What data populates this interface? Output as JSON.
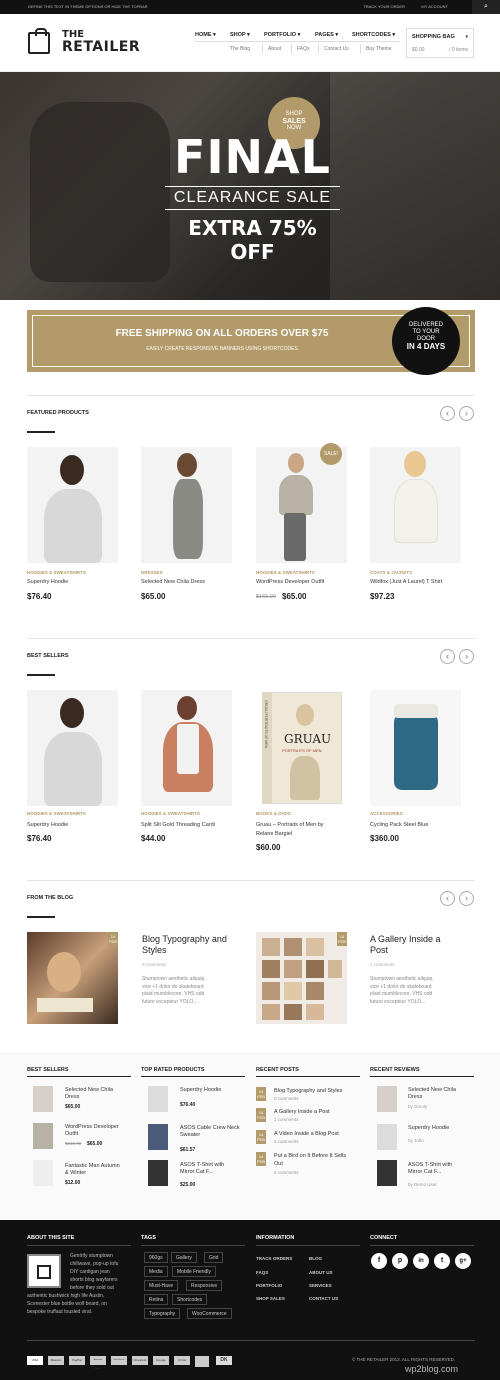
{
  "topbar": {
    "left": "DEFINE THIS TEXT IN THEME OPTIONS OR HIDE THE TOPBAR",
    "track": "TRACK YOUR ORDER",
    "account": "MY ACCOUNT",
    "search": "⌕"
  },
  "logo": {
    "line1": "THE",
    "line2": "RETAILER"
  },
  "nav": {
    "items": [
      "HOME ▾",
      "SHOP ▾",
      "PORTFOLIO ▾",
      "PAGES ▾",
      "SHORTCODES ▾"
    ],
    "sub": [
      "The Blog",
      "About",
      "FAQs",
      "Contact Us",
      "Buy Theme"
    ]
  },
  "bag": {
    "title": "SHOPPING BAG",
    "amount": "$0.00",
    "items": "/ 0 items",
    "chevron": "▾"
  },
  "hero": {
    "badge_top": "SHOP",
    "badge_mid": "SALES",
    "badge_bot": "NOW",
    "title": "FINAL",
    "subtitle": "CLEARANCE SALE",
    "offer": "EXTRA 75% OFF"
  },
  "shipping": {
    "title": "FREE SHIPPING ON ALL ORDERS OVER $75",
    "subtitle": "EASILY CREATE RESPONSIVE BANNERS USING SHORTCODES",
    "b1": "DELIVERED",
    "b2": "TO YOUR",
    "b3": "DOOR",
    "b4": "IN 4 DAYS"
  },
  "arrows": {
    "prev": "‹",
    "next": "›"
  },
  "featured": {
    "title": "FEATURED PRODUCTS",
    "sale": "SALE!",
    "products": [
      {
        "cat": "HOODIES & SWEATSHIRTS",
        "name": "Superdry Hoodie",
        "price": "$76.40",
        "old": ""
      },
      {
        "cat": "DRESSES",
        "name": "Selected New Chila Dress",
        "price": "$65.00",
        "old": ""
      },
      {
        "cat": "HOODIES & SWEATSHIRTS",
        "name": "WordPress Developer Outfit",
        "price": "$65.00",
        "old": "$165.00"
      },
      {
        "cat": "COATS & JACKETS",
        "name": "Wildfox (Just A Laurel) T Shirt",
        "price": "$97.23",
        "old": ""
      }
    ]
  },
  "best": {
    "title": "BEST SELLERS",
    "products": [
      {
        "cat": "HOODIES & SWEATSHIRTS",
        "name": "Superdry Hoodie",
        "name2": "",
        "price": "$76.40"
      },
      {
        "cat": "HOODIES & SWEATSHIRTS",
        "name": "Split Slit Gold Threading Cardi",
        "name2": "",
        "price": "$44.00"
      },
      {
        "cat": "BOOKS & DVDS",
        "name": "Gruau – Portraits of Men by",
        "name2": "Relane Bargiel",
        "price": "$60.00"
      },
      {
        "cat": "ACCESSORIES",
        "name": "Cycling Pack Steel Blue",
        "name2": "",
        "price": "$360.00"
      }
    ],
    "book_title": "GRUAU",
    "book_sub": "PORTRAITS OF MEN",
    "book_spine": "GRUAU PORTRAITS OF MEN"
  },
  "blog": {
    "title": "FROM THE BLOG",
    "posts": [
      {
        "title1": "Blog Typography and",
        "title2": "Styles",
        "meta": "0 comments",
        "text": [
          "Stumptown aesthetic aliquip,",
          "vice +1 dolor do skateboard",
          "plaid mumblecore. VHS odd",
          "future excepteur YOLO..."
        ],
        "day": "14",
        "mon": "FEB"
      },
      {
        "title1": "A Gallery Inside a",
        "title2": "Post",
        "meta": "1 comments",
        "text": [
          "Stumptown aesthetic aliquip,",
          "vice +1 dolor do skateboard",
          "plaid mumblecore. VHS odd",
          "future excepteur YOLO..."
        ],
        "day": "14",
        "mon": "FEB"
      }
    ]
  },
  "widgets": {
    "best": {
      "title": "BEST SELLERS",
      "items": [
        {
          "name": "Selected New Chila",
          "name2": "Dress",
          "price": "$65.00",
          "old": ""
        },
        {
          "name": "WordPress Developer",
          "name2": "Outfit",
          "price": "$65.00",
          "old": "$165.00"
        },
        {
          "name": "Fantastic Man Autumn",
          "name2": "& Winter",
          "price": "$12.00",
          "old": ""
        }
      ]
    },
    "top": {
      "title": "TOP RATED PRODUCTS",
      "items": [
        {
          "name": "Superdry Hoodie",
          "name2": "",
          "price": "$76.40"
        },
        {
          "name": "ASOS Cable Crew Neck",
          "name2": "Sweater",
          "price": "$61.57"
        },
        {
          "name": "ASOS T-Shirt with",
          "name2": "Mirror Cat F...",
          "price": "$25.00"
        }
      ]
    },
    "posts": {
      "title": "RECENT POSTS",
      "items": [
        {
          "day": "14",
          "mon": "FEB",
          "name": "Blog Typography and Styles",
          "name2": "",
          "sub": "0 comments"
        },
        {
          "day": "14",
          "mon": "FEB",
          "name": "A Gallery Inside a Post",
          "name2": "",
          "sub": "1 comments"
        },
        {
          "day": "14",
          "mon": "FEB",
          "name": "A Video Inside a Blog Post",
          "name2": "",
          "sub": "2 comments"
        },
        {
          "day": "14",
          "mon": "FEB",
          "name": "Put a Bird on It Before It Sells",
          "name2": "Out",
          "sub": "6 comments"
        }
      ]
    },
    "reviews": {
      "title": "RECENT REVIEWS",
      "items": [
        {
          "name": "Selected New Chila",
          "name2": "Dress",
          "sub": "by Gmoty"
        },
        {
          "name": "Superdry Hoodie",
          "name2": "",
          "sub": "by John"
        },
        {
          "name": "ASOS T-Shirt with",
          "name2": "Mirror Cat F...",
          "sub": "by Demo User"
        }
      ]
    }
  },
  "footer": {
    "about_title": "ABOUT THIS SITE",
    "about_text": [
      "Gentrify stumptown",
      "chillwave, pop-up tofu",
      "DIY cardigan jean",
      "shorts blog wayfarers",
      "before they sold out",
      "authentic bushwick high life Austin.",
      "Scenester blue bottle wolf beard, on",
      "bespoke truffaut tousled viral."
    ],
    "tags_title": "TAGS",
    "tags": [
      "960gs",
      "Gallery",
      "Grid",
      "Media",
      "Mobile Friendly",
      "Must-Have",
      "Responsive",
      "Retina",
      "Shortcodes",
      "Typography",
      "WooCommerce"
    ],
    "info_title": "INFORMATION",
    "info_left": [
      "TRACK ORDERS",
      "FAQS",
      "PORTFOLIO",
      "SHOP SALES"
    ],
    "info_right": [
      "BLOG",
      "ABOUT US",
      "SERVICES",
      "CONTACT US"
    ],
    "connect_title": "CONNECT",
    "social": [
      "f",
      "p",
      "in",
      "t",
      "g+"
    ],
    "cards": [
      "VISA",
      "Maestro",
      "PayPal",
      "American Express",
      "Visa Electron",
      "Moneybook",
      "Google",
      "Cirrus",
      "DK"
    ],
    "copyright": "© THE RETAILER 2013. ALL RIGHTS RESERVED.",
    "watermark": "wp2blog.com"
  }
}
